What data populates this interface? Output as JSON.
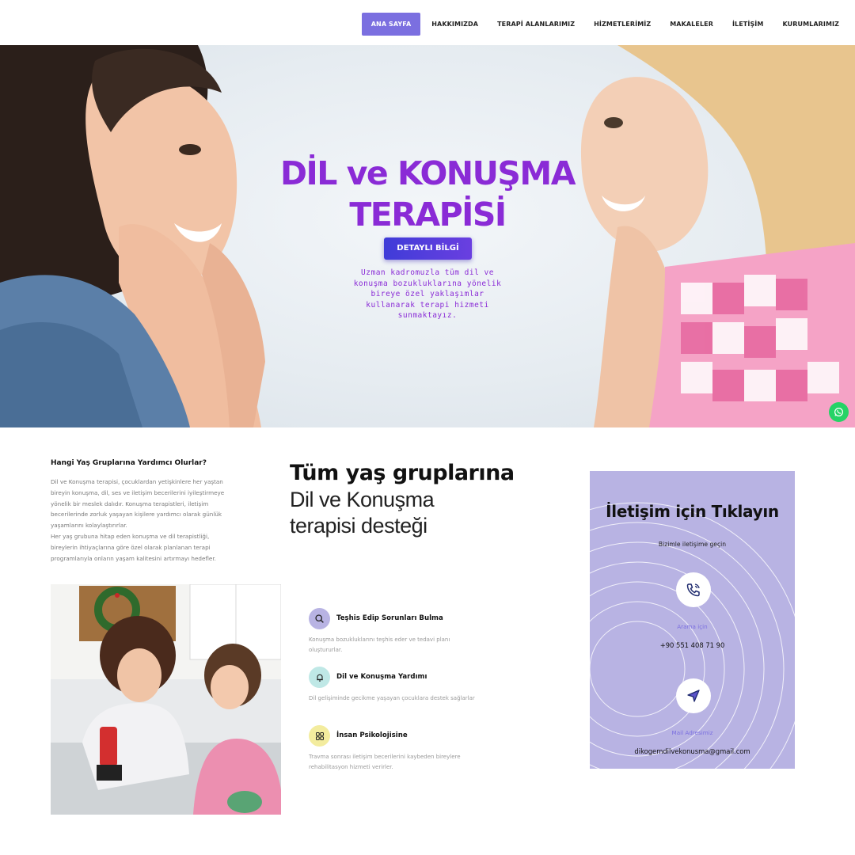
{
  "nav": {
    "items": [
      {
        "label": "ANA SAYFA"
      },
      {
        "label": "HAKKIMIZDA"
      },
      {
        "label": "TERAPİ ALANLARIMIZ"
      },
      {
        "label": "HİZMETLERİMİZ"
      },
      {
        "label": "MAKALELER"
      },
      {
        "label": "İLETİŞİM"
      },
      {
        "label": "KURUMLARIMIZ"
      }
    ],
    "active_color": "#7b6fe0"
  },
  "hero": {
    "title_line1": "DİL ve KONUŞMA",
    "title_line2": "TERAPİSİ",
    "button": "DETAYLI BİLGİ",
    "subtitle": "Uzman kadromuzla tüm dil ve konuşma bozukluklarına yönelik bireye özel yaklaşımlar kullanarak terapi hizmeti sunmaktayız.",
    "title_color": "#8a2bd6"
  },
  "whatsapp": {
    "icon": "whatsapp-icon",
    "color": "#25d366"
  },
  "info": {
    "title": "Hangi Yaş Gruplarına Yardımcı Olurlar?",
    "paragraph1": "Dil ve Konuşma terapisi, çocuklardan yetişkinlere her yaştan bireyin konuşma, dil, ses ve iletişim becerilerini iyileştirmeye yönelik bir meslek dalıdır. Konuşma terapistleri, iletişim becerilerinde zorluk yaşayan kişilere yardımcı olarak günlük yaşamlarını kolaylaştırırlar.",
    "paragraph2": "Her yaş grubuna hitap eden konuşma ve dil terapistliği, bireylerin ihtiyaçlarına göre özel olarak planlanan terapi programlarıyla onların yaşam kalitesini artırmayı hedefler."
  },
  "heading": {
    "bold": "Tüm yaş gruplarına",
    "line2": "Dil ve Konuşma",
    "line3": "terapisi desteği"
  },
  "features": [
    {
      "title": "Teşhis Edip Sorunları Bulma",
      "desc": "Konuşma bozukluklarını teşhis eder ve tedavi planı oluştururlar.",
      "icon": "magnifier-icon",
      "color": "#b8b3e3"
    },
    {
      "title": "Dil ve Konuşma Yardımı",
      "desc": "Dil gelişiminde gecikme yaşayan çocuklara destek sağlarlar",
      "icon": "bell-icon",
      "color": "#bfe8e6"
    },
    {
      "title": "İnsan Psikolojisine",
      "desc": "Travma sonrası iletişim becerilerini kaybeden bireylere rehabilitasyon hizmeti verirler.",
      "icon": "grid-icon",
      "color": "#f3ec9e"
    }
  ],
  "contact": {
    "title": "İletişim için Tıklayın",
    "subtitle": "Bizimle iletişime geçin",
    "phone_label": "Arama için",
    "phone": "+90 551 408 71 90",
    "mail_label": "Mail Adresimiz",
    "email": "dikogemdilvekonusma@gmail.com",
    "card_color": "#b8b3e3"
  }
}
